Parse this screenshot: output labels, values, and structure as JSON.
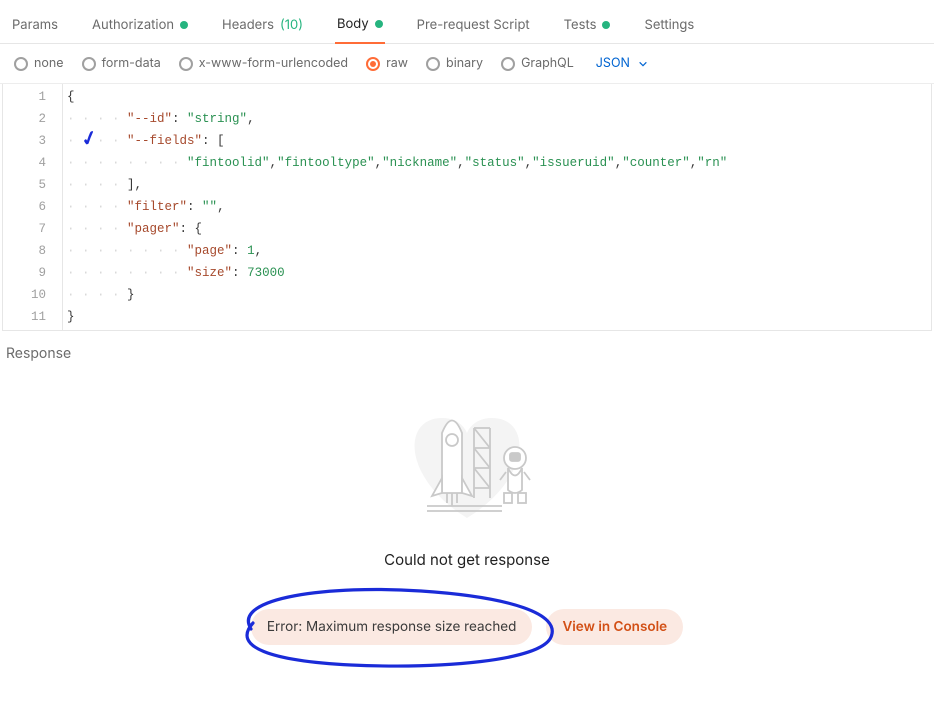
{
  "tabs": {
    "params": "Params",
    "authorization": "Authorization",
    "headers": "Headers",
    "headers_count": "(10)",
    "body": "Body",
    "prerequest": "Pre-request Script",
    "tests": "Tests",
    "settings": "Settings"
  },
  "body_types": {
    "none": "none",
    "formdata": "form-data",
    "urlencoded": "x-www-form-urlencoded",
    "raw": "raw",
    "binary": "binary",
    "graphql": "GraphQL",
    "format": "JSON"
  },
  "editor": {
    "lines": [
      "1",
      "2",
      "3",
      "4",
      "5",
      "6",
      "7",
      "8",
      "9",
      "10",
      "11"
    ],
    "content": {
      "l1_brace_open": "{",
      "l2_key": "\"--id\"",
      "l2_val": "\"string\"",
      "l3_key": "\"--fields\"",
      "l3_br": "[",
      "l4_values": [
        "\"fintoolid\"",
        "\"fintooltype\"",
        "\"nickname\"",
        "\"status\"",
        "\"issueruid\"",
        "\"counter\"",
        "\"rn\""
      ],
      "l5_close": "],",
      "l6_key": "\"filter\"",
      "l6_val": "\"\"",
      "l7_key": "\"pager\"",
      "l7_val": "{",
      "l8_key": "\"page\"",
      "l8_val": "1",
      "l9_key": "\"size\"",
      "l9_val": "73000",
      "l10_close": "}",
      "l11_close": "}"
    }
  },
  "response": {
    "title": "Response",
    "message": "Could not get response",
    "error": "Error: Maximum response size reached",
    "view_console": "View in Console"
  }
}
